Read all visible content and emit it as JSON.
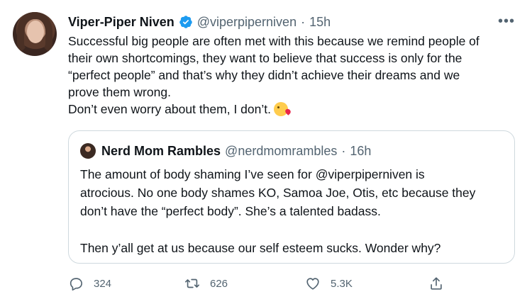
{
  "tweet": {
    "author_name": "Viper-Piper Niven",
    "handle": "@viperpiperniven",
    "separator": "·",
    "time": "15h",
    "more_label": "•••",
    "text": "Successful big people are often met with this because we remind people of\ntheir own shortcomings, they want to believe that success is only for the\n“perfect people” and that’s why they didn’t achieve their dreams and we\nprove them wrong.\nDon’t even worry about them, I don’t.",
    "emoji": "kissing-face-heart-emoji"
  },
  "quote": {
    "author_name": "Nerd Mom Rambles",
    "handle": "@nerdmomrambles",
    "separator": "·",
    "time": "16h",
    "text": "The amount of body shaming I’ve seen for @viperpiperniven is\natrocious. No one body shames KO, Samoa Joe, Otis, etc because they\ndon’t have the “perfect body”. She’s a talented badass.\n\nThen y’all get at us because our self esteem sucks. Wonder why?"
  },
  "actions": {
    "reply_count": "324",
    "retweet_count": "626",
    "like_count": "5.3K"
  },
  "colors": {
    "text": "#0f1419",
    "secondary": "#536471",
    "verified": "#1d9bf0",
    "border": "#cfd9de"
  }
}
